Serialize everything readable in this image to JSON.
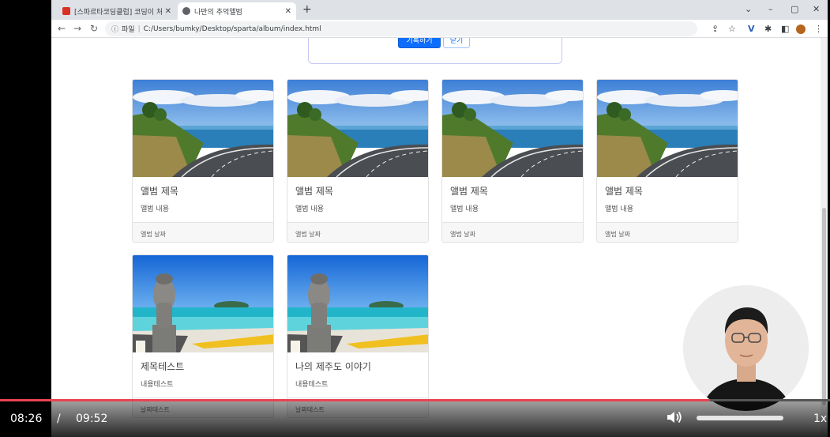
{
  "tabs": [
    {
      "title": "[스파르타코딩클럽] 코딩이 처음",
      "favicon_color": "#d93025"
    },
    {
      "title": "나만의 추억앨범",
      "favicon_color": "#5f6368"
    }
  ],
  "address": {
    "label": "파일",
    "url": "C:/Users/bumky/Desktop/sparta/album/index.html"
  },
  "form": {
    "save_label": "기록하기",
    "close_label": "닫기"
  },
  "cards": [
    {
      "title": "앨범 제목",
      "text": "앨범 내용",
      "date": "앨범 날짜",
      "image": "road"
    },
    {
      "title": "앨범 제목",
      "text": "앨범 내용",
      "date": "앨범 날짜",
      "image": "road"
    },
    {
      "title": "앨범 제목",
      "text": "앨범 내용",
      "date": "앨범 날짜",
      "image": "road"
    },
    {
      "title": "앨범 제목",
      "text": "앨범 내용",
      "date": "앨범 날짜",
      "image": "road"
    },
    {
      "title": "제목테스트",
      "text": "내용테스트",
      "date": "날짜테스트",
      "image": "statue"
    },
    {
      "title": "나의 제주도 이야기",
      "text": "내용테스트",
      "date": "날짜테스트",
      "image": "statue"
    }
  ],
  "player": {
    "current_time": "08:26",
    "separator": "/",
    "total_time": "09:52",
    "progress_fraction": 0.855,
    "volume_fraction": 1.0,
    "speed": "1x",
    "accent_color": "#e8434f"
  }
}
